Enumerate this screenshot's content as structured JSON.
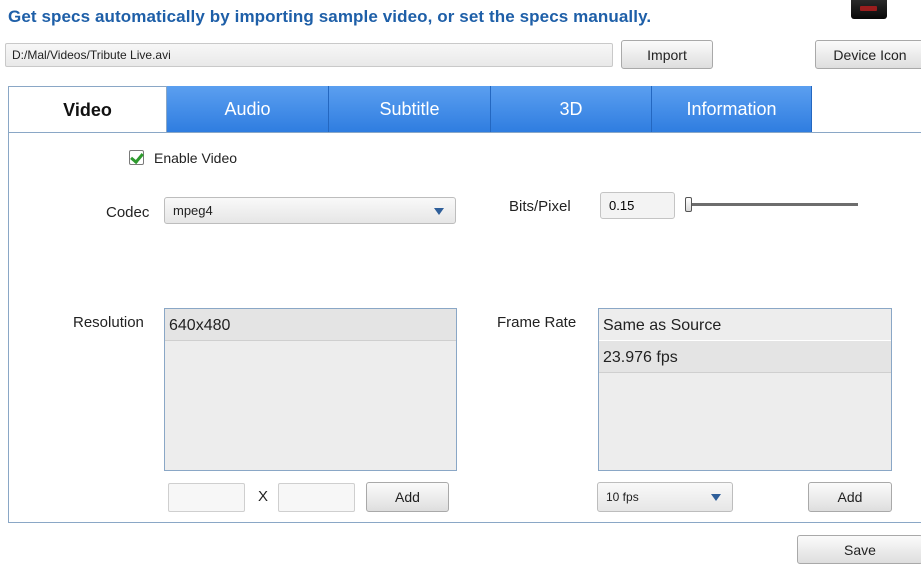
{
  "header": {
    "title": "Get specs automatically by importing sample video, or set the specs manually.",
    "source_path": "D:/Mal/Videos/Tribute Live.avi",
    "import_label": "Import",
    "device_icon_label": "Device Icon"
  },
  "tabs": [
    {
      "label": "Video",
      "active": true
    },
    {
      "label": "Audio",
      "active": false
    },
    {
      "label": "Subtitle",
      "active": false
    },
    {
      "label": "3D",
      "active": false
    },
    {
      "label": "Information",
      "active": false
    }
  ],
  "video": {
    "enable_label": "Enable Video",
    "enable_checked": true,
    "codec_label": "Codec",
    "codec_value": "mpeg4",
    "bits_label": "Bits/Pixel",
    "bits_value": "0.15",
    "bits_slider_level": 0.0,
    "resolution_label": "Resolution",
    "resolutions": [
      "640x480"
    ],
    "width_value": "",
    "height_value": "",
    "x_label": "X",
    "add_label": "Add",
    "frame_rate_label": "Frame Rate",
    "frame_rates": [
      "Same as Source",
      "23.976 fps"
    ],
    "fps_select_value": "10 fps",
    "fr_add_label": "Add"
  },
  "footer": {
    "save_label": "Save"
  },
  "colors": {
    "title": "#1e5fa8",
    "tab_blue": "#3d8be8",
    "check_green": "#2e9a2e"
  }
}
